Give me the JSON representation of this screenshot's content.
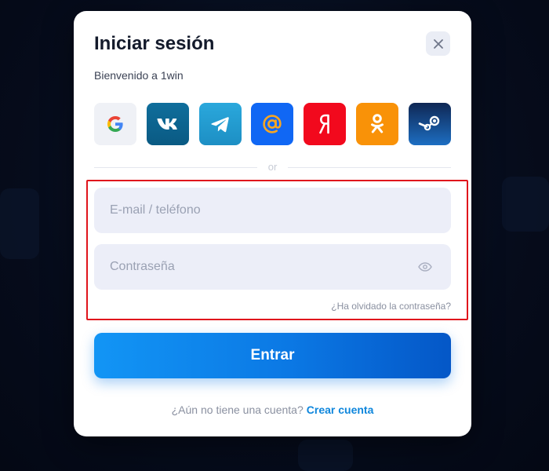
{
  "modal": {
    "title": "Iniciar sesión",
    "subtitle": "Bienvenido a 1win",
    "close_icon": "close-icon"
  },
  "socials": [
    {
      "name": "google",
      "icon": "google-icon",
      "color": "#eff1f6"
    },
    {
      "name": "vk",
      "icon": "vk-icon",
      "color": "#0f6e9c"
    },
    {
      "name": "telegram",
      "icon": "telegram-icon",
      "color": "#2aa8dc"
    },
    {
      "name": "mail",
      "icon": "at-icon",
      "color": "#1067f4"
    },
    {
      "name": "yandex",
      "icon": "yandex-icon",
      "color": "#f2091d"
    },
    {
      "name": "odnoklassniki",
      "icon": "ok-icon",
      "color": "#f99208"
    },
    {
      "name": "steam",
      "icon": "steam-icon",
      "color": "#1d6ec2"
    }
  ],
  "divider": {
    "text": "or"
  },
  "form": {
    "email": {
      "placeholder": "E-mail / teléfono",
      "value": ""
    },
    "password": {
      "placeholder": "Contraseña",
      "value": "",
      "toggle_icon": "eye-icon"
    },
    "forgot_label": "¿Ha olvidado la contraseña?",
    "submit_label": "Entrar"
  },
  "register": {
    "prompt": "¿Aún no tiene una cuenta?",
    "link_label": "Crear cuenta"
  },
  "colors": {
    "accent": "#0b78e4",
    "link": "#0e86dc",
    "highlight_border": "#e0141c",
    "background": "#060c1c"
  }
}
